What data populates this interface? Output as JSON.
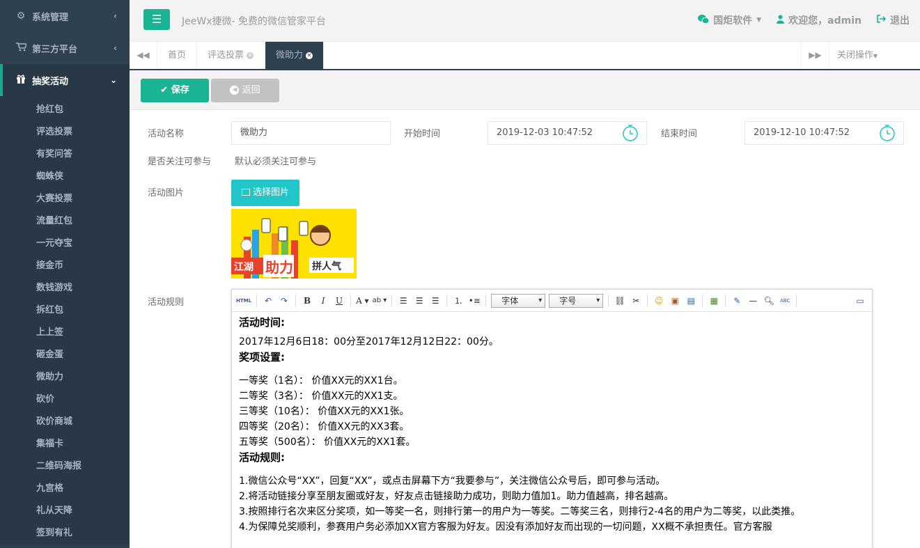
{
  "sidebar": {
    "top": [
      {
        "label": "系统管理",
        "icon": "gear-icon"
      },
      {
        "label": "第三方平台",
        "icon": "cart-icon"
      }
    ],
    "active": {
      "label": "抽奖活动",
      "icon": "gift-icon"
    },
    "subitems": [
      "抢红包",
      "评选投票",
      "有奖问答",
      "蜘蛛侠",
      "大赛投票",
      "流量红包",
      "一元夺宝",
      "接金币",
      "数钱游戏",
      "拆红包",
      "上上签",
      "砸金蛋",
      "微助力",
      "砍价",
      "砍价商城",
      "集福卡",
      "二维码海报",
      "九宫格",
      "礼从天降",
      "签到有礼"
    ]
  },
  "header": {
    "brand": "JeeWx捷微- 免费的微信管家平台",
    "company": "国炬软件",
    "welcome": "欢迎您，admin",
    "logout": "退出"
  },
  "tabs": {
    "items": [
      {
        "label": "首页",
        "closable": false
      },
      {
        "label": "评选投票",
        "closable": true
      },
      {
        "label": "微助力",
        "closable": true,
        "active": true
      }
    ],
    "close_ops": "关闭操作"
  },
  "actions": {
    "save": "保存",
    "back": "返回"
  },
  "form": {
    "name_label": "活动名称",
    "name_value": "微助力",
    "start_label": "开始时间",
    "start_value": "2019-12-03 10:47:52",
    "end_label": "结束时间",
    "end_value": "2019-12-10 10:47:52",
    "follow_label": "是否关注可参与",
    "follow_value": "默认必须关注可参与",
    "image_label": "活动图片",
    "image_button": "选择图片",
    "image_text": [
      "江湖",
      "助力",
      "拼人气"
    ],
    "rules_label": "活动规则"
  },
  "editor": {
    "toolbar": {
      "html": "HTML",
      "font": "字体",
      "size": "字号"
    },
    "content": {
      "h1": "活动时间:",
      "time": "2017年12月6日18：00分至2017年12月12日22：00分。",
      "h2": "奖项设置:",
      "prizes": [
        "一等奖（1名）：  价值XX元的XX1台。",
        "二等奖（3名）：  价值XX元的XX1支。",
        "三等奖（10名）： 价值XX元的XX1张。",
        "四等奖（20名）： 价值XX元的XX3套。",
        "五等奖（500名）： 价值XX元的XX1套。"
      ],
      "h3": "活动规则:",
      "rules": [
        "1.微信公众号“XX”，回复“XX”，或点击屏幕下方“我要参与”，关注微信公众号后，即可参与活动。",
        "2.将活动链接分享至朋友圈或好友，好友点击链接助力成功，则助力值加1。助力值越高，排名越高。",
        "3.按照排行名次来区分奖项，如一等奖一名，则排行第一的用户为一等奖。二等奖三名，则排行2-4名的用户为二等奖，以此类推。",
        "4.为保障兑奖顺利，参赛用户务必添加XX官方客服为好友。因没有添加好友而出现的一切问题，XX概不承担责任。官方客服"
      ]
    }
  },
  "colors": {
    "sidebar": "#2f4050",
    "accent": "#1ab394",
    "info": "#23c6c8"
  }
}
